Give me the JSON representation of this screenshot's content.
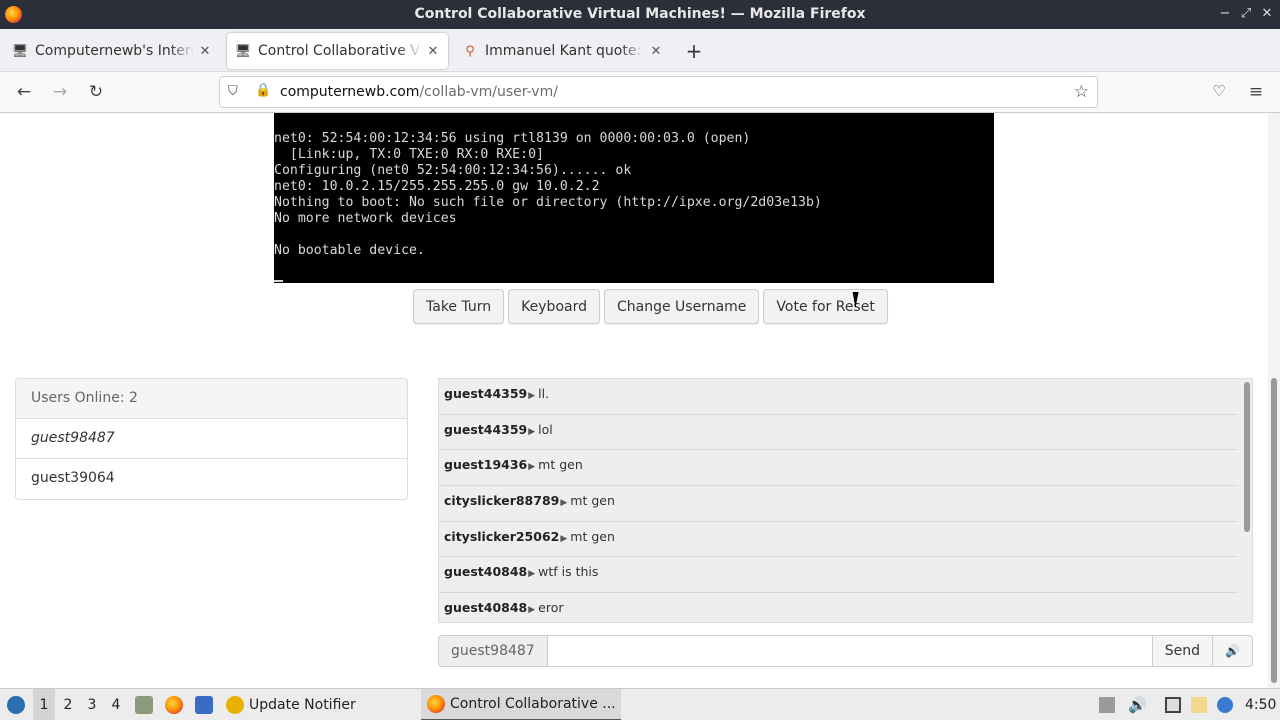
{
  "window": {
    "title": "Control Collaborative Virtual Machines! — Mozilla Firefox",
    "controls": [
      "−",
      "⤢",
      "✕"
    ]
  },
  "tabs": [
    {
      "label": "Computernewb's Internet",
      "icon": "monitor-icon",
      "active": false
    },
    {
      "label": "Control Collaborative Virtual",
      "icon": "monitor-icon",
      "active": true
    },
    {
      "label": "Immanuel Kant quote: Th",
      "icon": "quote-icon",
      "active": false
    }
  ],
  "newtab_label": "+",
  "nav": {
    "back": "←",
    "forward": "→",
    "reload": "↻",
    "url_host": "computernewb.com",
    "url_path": "/collab-vm/user-vm/"
  },
  "vm": {
    "terminal_text": "features: DNS HTTP iSCSI TFTP AoE ELF MBOOT PXE bzImage Menu PXEXT\n\nnet0: 52:54:00:12:34:56 using rtl8139 on 0000:00:03.0 (open)\n  [Link:up, TX:0 TXE:0 RX:0 RXE:0]\nConfiguring (net0 52:54:00:12:34:56)...... ok\nnet0: 10.0.2.15/255.255.255.0 gw 10.0.2.2\nNothing to boot: No such file or directory (http://ipxe.org/2d03e13b)\nNo more network devices\n\nNo bootable device.",
    "buttons": {
      "take_turn": "Take Turn",
      "keyboard": "Keyboard",
      "change_username": "Change Username",
      "vote_reset": "Vote for Reset"
    }
  },
  "users": {
    "header": "Users Online: 2",
    "list": [
      "guest98487",
      "guest39064"
    ]
  },
  "chat": {
    "messages": [
      {
        "user": "guest44359",
        "text": "ll."
      },
      {
        "user": "guest44359",
        "text": "lol"
      },
      {
        "user": "guest19436",
        "text": "mt gen"
      },
      {
        "user": "cityslicker88789",
        "text": "mt gen"
      },
      {
        "user": "cityslicker25062",
        "text": "mt gen"
      },
      {
        "user": "guest40848",
        "text": "wtf is this"
      },
      {
        "user": "guest40848",
        "text": "eror"
      }
    ],
    "arrow": "▶",
    "username_label": "guest98487",
    "input_value": "",
    "send_label": "Send",
    "speaker": "🔊"
  },
  "taskbar": {
    "workspaces": [
      "1",
      "2",
      "3",
      "4"
    ],
    "update_notifier": "Update Notifier",
    "firefox_task": "Control Collaborative ...",
    "clock": "4:50"
  },
  "colors": {
    "titlebar": "#2b2f3a",
    "vm_bg": "#000000",
    "chat_bg": "#eeeeee"
  }
}
